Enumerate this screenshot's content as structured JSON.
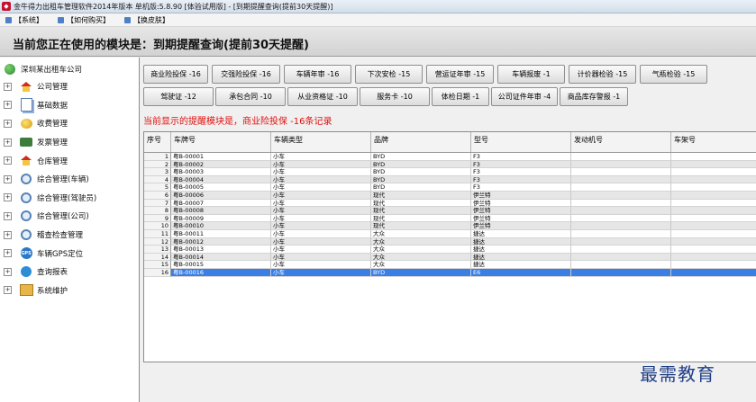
{
  "window": {
    "title": "金牛得力出租车管理软件2014年版本 单机版:5.8.90 [体验试用版] - [到期提醒查询(提前30天提醒)]"
  },
  "menubar": {
    "items": [
      {
        "label": "【系统】",
        "icon": "menu-icon"
      },
      {
        "label": "【如何购买】",
        "icon": "menu-icon"
      },
      {
        "label": "【换皮肤】",
        "icon": "menu-icon"
      }
    ]
  },
  "header": {
    "text": "当前您正在使用的模块是：到期提醒查询(提前30天提醒)"
  },
  "sidebar": {
    "root_label": "深圳某出租车公司",
    "items": [
      {
        "label": "公司管理",
        "icon": "house-icon"
      },
      {
        "label": "基础数据",
        "icon": "document-icon"
      },
      {
        "label": "收费管理",
        "icon": "coins-icon"
      },
      {
        "label": "发票管理",
        "icon": "truck-icon"
      },
      {
        "label": "仓库管理",
        "icon": "house-icon"
      },
      {
        "label": "综合管理(车辆)",
        "icon": "wrench-icon"
      },
      {
        "label": "综合管理(驾驶员)",
        "icon": "wrench-icon"
      },
      {
        "label": "综合管理(公司)",
        "icon": "wrench-icon"
      },
      {
        "label": "稽查检查管理",
        "icon": "wrench-icon"
      },
      {
        "label": "车辆GPS定位",
        "icon": "gps-icon"
      },
      {
        "label": "查询报表",
        "icon": "report-icon"
      },
      {
        "label": "系统维护",
        "icon": "system-icon"
      }
    ]
  },
  "reminder_buttons": {
    "row1": [
      {
        "label": "商业险投保 -16"
      },
      {
        "label": "交强险投保 -16"
      },
      {
        "label": "车辆年审 -16"
      },
      {
        "label": "下次安检 -15"
      },
      {
        "label": "营运证年审 -15"
      },
      {
        "label": "车辆报废 -1"
      },
      {
        "label": "计价器检验 -15"
      },
      {
        "label": "气瓶检验 -15"
      }
    ],
    "row2": [
      {
        "label": "驾驶证 -12"
      },
      {
        "label": "承包合同 -10"
      },
      {
        "label": "从业资格证 -10"
      },
      {
        "label": "服务卡 -10"
      },
      {
        "label": "体检日期 -1"
      },
      {
        "label": "公司证件年审 -4"
      },
      {
        "label": "商品库存警报 -1"
      }
    ]
  },
  "notice": {
    "text": "当前显示的提醒模块是，商业险投保  -16条记录"
  },
  "grid": {
    "headers": [
      "序号",
      "车牌号",
      "车辆类型",
      "品牌",
      "型号",
      "发动机号",
      "车架号"
    ],
    "selected_row": 16,
    "rows": [
      [
        "1",
        "粤B-00001",
        "小车",
        "BYD",
        "F3",
        "",
        ""
      ],
      [
        "2",
        "粤B-00002",
        "小车",
        "BYD",
        "F3",
        "",
        ""
      ],
      [
        "3",
        "粤B-00003",
        "小车",
        "BYD",
        "F3",
        "",
        ""
      ],
      [
        "4",
        "粤B-00004",
        "小车",
        "BYD",
        "F3",
        "",
        ""
      ],
      [
        "5",
        "粤B-00005",
        "小车",
        "BYD",
        "F3",
        "",
        ""
      ],
      [
        "6",
        "粤B-00006",
        "小车",
        "现代",
        "伊兰特",
        "",
        ""
      ],
      [
        "7",
        "粤B-00007",
        "小车",
        "现代",
        "伊兰特",
        "",
        ""
      ],
      [
        "8",
        "粤B-00008",
        "小车",
        "现代",
        "伊兰特",
        "",
        ""
      ],
      [
        "9",
        "粤B-00009",
        "小车",
        "现代",
        "伊兰特",
        "",
        ""
      ],
      [
        "10",
        "粤B-00010",
        "小车",
        "现代",
        "伊兰特",
        "",
        ""
      ],
      [
        "11",
        "粤B-00011",
        "小车",
        "大众",
        "捷达",
        "",
        ""
      ],
      [
        "12",
        "粤B-00012",
        "小车",
        "大众",
        "捷达",
        "",
        ""
      ],
      [
        "13",
        "粤B-00013",
        "小车",
        "大众",
        "捷达",
        "",
        ""
      ],
      [
        "14",
        "粤B-00014",
        "小车",
        "大众",
        "捷达",
        "",
        ""
      ],
      [
        "15",
        "粤B-00015",
        "小车",
        "大众",
        "捷达",
        "",
        ""
      ],
      [
        "16",
        "粤B-00016",
        "小车",
        "BYD",
        "E6",
        "",
        ""
      ]
    ]
  },
  "watermark": {
    "text": "最需教育"
  },
  "colors": {
    "selected_row": "#3a7fe6",
    "notice": "#e01010",
    "watermark": "#1f3f87"
  }
}
